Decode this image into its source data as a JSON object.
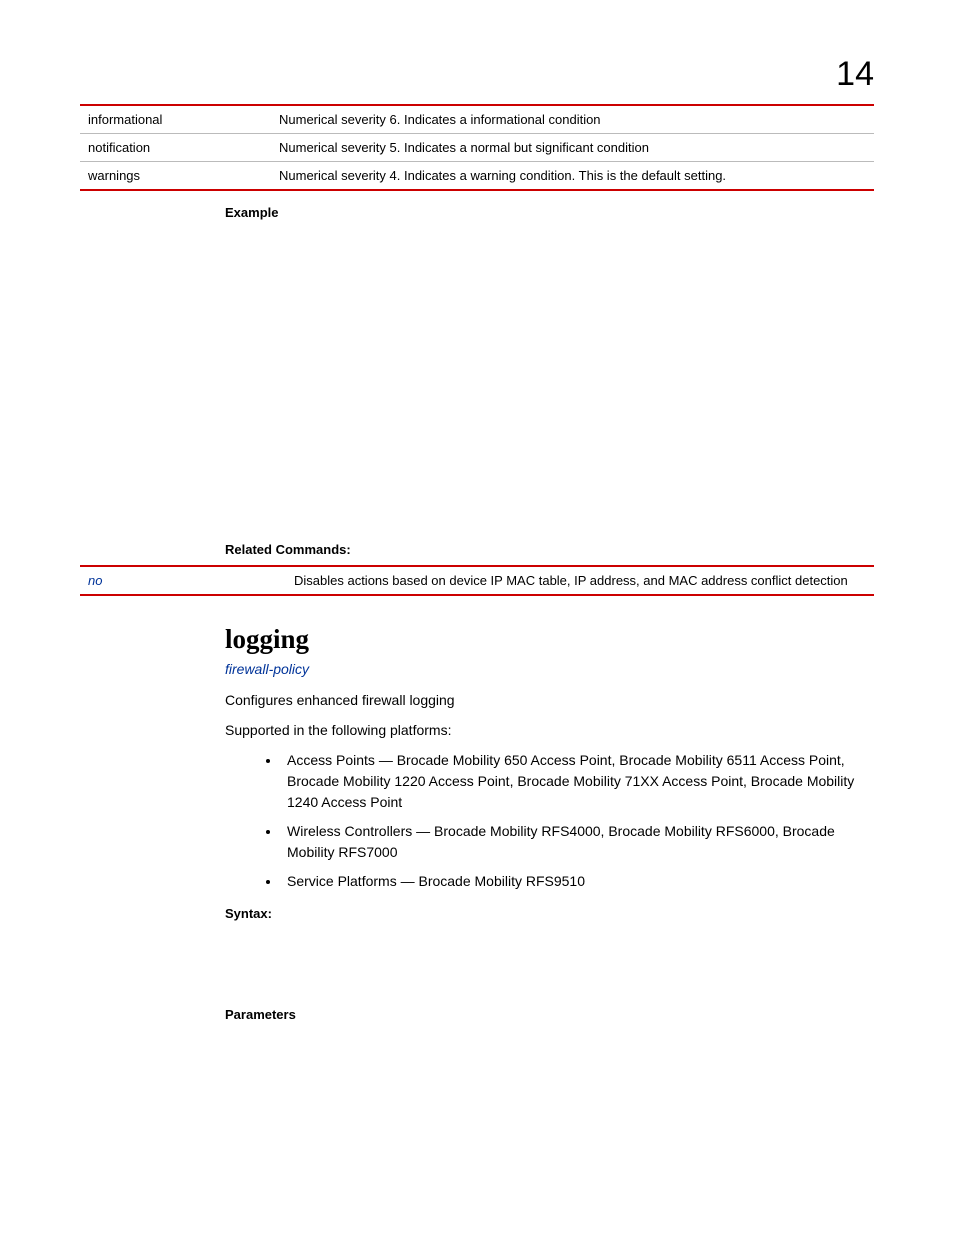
{
  "chapter_number": "14",
  "severity_rows": [
    {
      "name": "informational",
      "desc": "Numerical severity 6. Indicates a informational condition"
    },
    {
      "name": "notification",
      "desc": "Numerical severity 5. Indicates a normal but significant condition"
    },
    {
      "name": "warnings",
      "desc": "Numerical severity 4. Indicates a warning condition. This is the default setting."
    }
  ],
  "example_label": "Example",
  "related_commands_label": "Related Commands:",
  "related_rows": [
    {
      "cmd": "no",
      "desc": "Disables actions based on device IP MAC table, IP address, and MAC address conflict detection"
    }
  ],
  "section": {
    "heading": "logging",
    "policy_link": "firewall-policy",
    "intro": "Configures enhanced firewall logging",
    "supported_label": "Supported in the following platforms:",
    "platforms": [
      "Access Points — Brocade Mobility 650 Access Point, Brocade Mobility 6511 Access Point, Brocade Mobility 1220 Access Point, Brocade Mobility 71XX Access Point, Brocade Mobility 1240 Access Point",
      "Wireless Controllers — Brocade Mobility RFS4000, Brocade Mobility RFS6000, Brocade Mobility RFS7000",
      "Service Platforms — Brocade Mobility RFS9510"
    ],
    "syntax_label": "Syntax:",
    "parameters_label": "Parameters"
  }
}
